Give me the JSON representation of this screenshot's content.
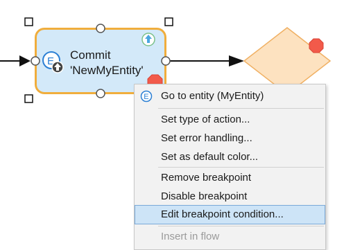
{
  "activity": {
    "line1": "Commit",
    "line2": "'NewMyEntity'"
  },
  "menu": {
    "go_to_entity": "Go to entity (MyEntity)",
    "set_type": "Set type of action...",
    "set_error": "Set error handling...",
    "set_default_color": "Set as default color...",
    "remove_breakpoint": "Remove breakpoint",
    "disable_breakpoint": "Disable breakpoint",
    "edit_breakpoint_condition": "Edit breakpoint condition...",
    "insert_in_flow": "Insert in flow"
  },
  "colors": {
    "activity_fill": "#d3e9f9",
    "activity_border": "#f0ad3c",
    "breakpoint": "#f25a4a",
    "decision_fill": "#fde2c0",
    "highlight": "#cde4f7"
  }
}
